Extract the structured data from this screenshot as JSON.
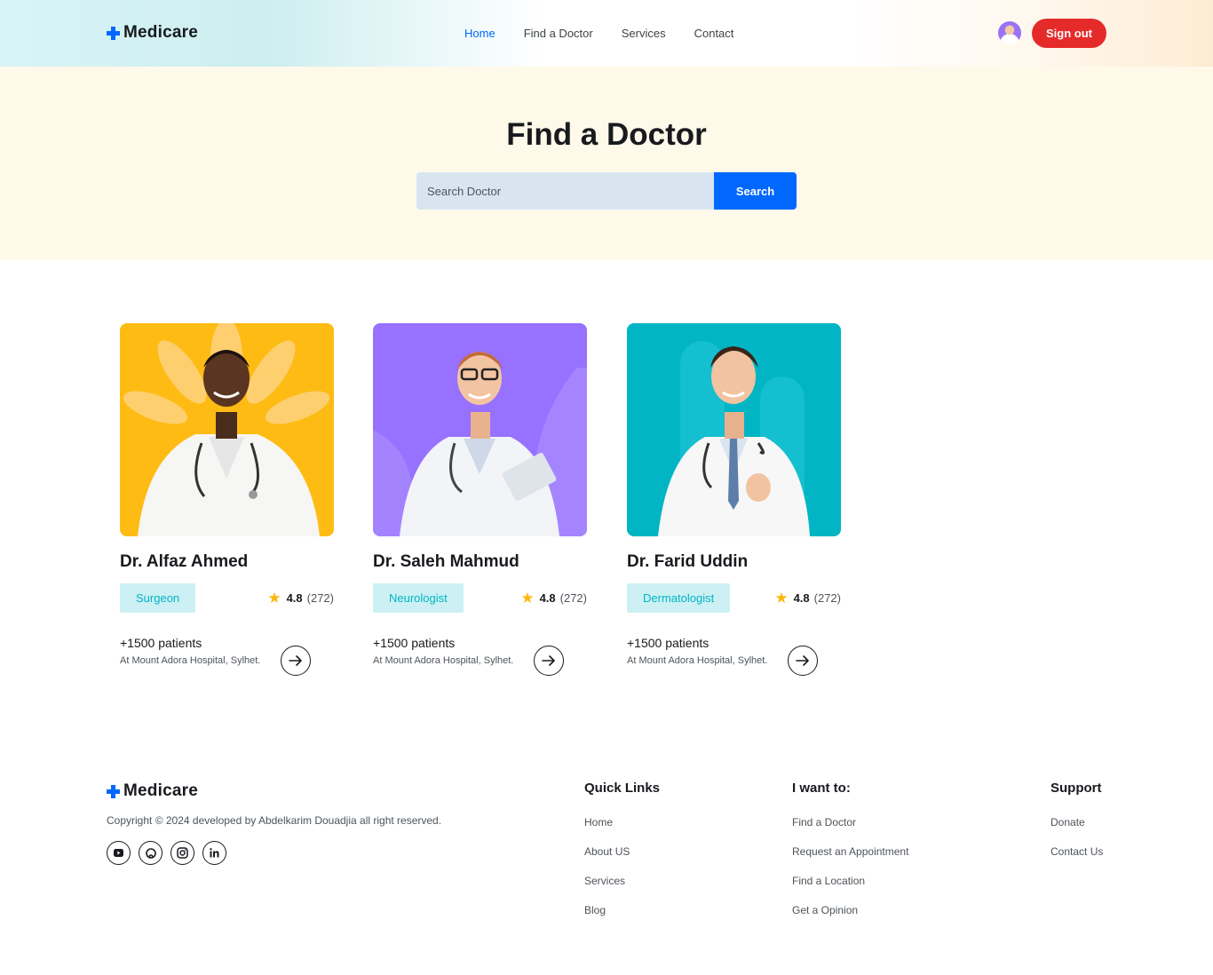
{
  "header": {
    "logo_text": "Medicare",
    "nav": [
      {
        "label": "Home",
        "active": true
      },
      {
        "label": "Find a Doctor",
        "active": false
      },
      {
        "label": "Services",
        "active": false
      },
      {
        "label": "Contact",
        "active": false
      }
    ],
    "signout_label": "Sign out"
  },
  "hero": {
    "title": "Find a Doctor",
    "search_placeholder": "Search Doctor",
    "search_button": "Search"
  },
  "doctors": [
    {
      "name": "Dr. Alfaz Ahmed",
      "specialty": "Surgeon",
      "rating": "4.8",
      "reviews": "(272)",
      "patients": "+1500 patients",
      "hospital": "At Mount Adora Hospital, Sylhet.",
      "photo_bg": "#febb13"
    },
    {
      "name": "Dr. Saleh Mahmud",
      "specialty": "Neurologist",
      "rating": "4.8",
      "reviews": "(272)",
      "patients": "+1500 patients",
      "hospital": "At Mount Adora Hospital, Sylhet.",
      "photo_bg": "#9771ff"
    },
    {
      "name": "Dr. Farid Uddin",
      "specialty": "Dermatologist",
      "rating": "4.8",
      "reviews": "(272)",
      "patients": "+1500 patients",
      "hospital": "At Mount Adora Hospital, Sylhet.",
      "photo_bg": "#01b5c5"
    }
  ],
  "footer": {
    "logo_text": "Medicare",
    "copyright": "Copyright © 2024 developed by Abdelkarim Douadjia all right reserved.",
    "socials": [
      "youtube-icon",
      "github-icon",
      "instagram-icon",
      "linkedin-icon"
    ],
    "quick_links": {
      "title": "Quick Links",
      "items": [
        "Home",
        "About US",
        "Services",
        "Blog"
      ]
    },
    "want_to": {
      "title": "I want to:",
      "items": [
        "Find a Doctor",
        "Request an Appointment",
        "Find a Location",
        "Get a Opinion"
      ]
    },
    "support": {
      "title": "Support",
      "items": [
        "Donate",
        "Contact Us"
      ]
    }
  },
  "colors": {
    "primary": "#0067ff",
    "signout": "#e52a2a",
    "star": "#feb60d",
    "specialty_text": "#01b5c5",
    "specialty_bg": "#ccf0f3"
  }
}
